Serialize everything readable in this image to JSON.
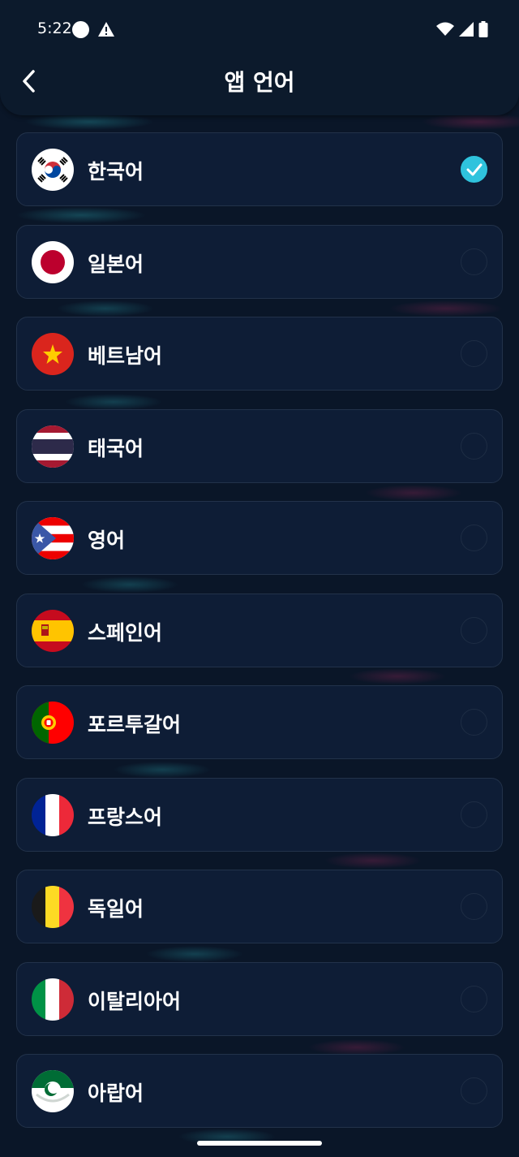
{
  "status_bar": {
    "time": "5:22"
  },
  "header": {
    "title": "앱 언어"
  },
  "languages": [
    {
      "label": "한국어",
      "flag": "korea-flag-icon",
      "selected": true
    },
    {
      "label": "일본어",
      "flag": "japan-flag-icon",
      "selected": false
    },
    {
      "label": "베트남어",
      "flag": "vietnam-flag-icon",
      "selected": false
    },
    {
      "label": "태국어",
      "flag": "thailand-flag-icon",
      "selected": false
    },
    {
      "label": "영어",
      "flag": "puerto-rico-flag-icon",
      "selected": false
    },
    {
      "label": "스페인어",
      "flag": "spain-flag-icon",
      "selected": false
    },
    {
      "label": "포르투갈어",
      "flag": "portugal-flag-icon",
      "selected": false
    },
    {
      "label": "프랑스어",
      "flag": "france-flag-icon",
      "selected": false
    },
    {
      "label": "독일어",
      "flag": "belgium-flag-icon",
      "selected": false
    },
    {
      "label": "이탈리아어",
      "flag": "italy-flag-icon",
      "selected": false
    },
    {
      "label": "아랍어",
      "flag": "arab-flag-icon",
      "selected": false
    }
  ],
  "colors": {
    "background": "#0a1628",
    "accent": "#2fc3dd",
    "card_border": "#22324a"
  }
}
